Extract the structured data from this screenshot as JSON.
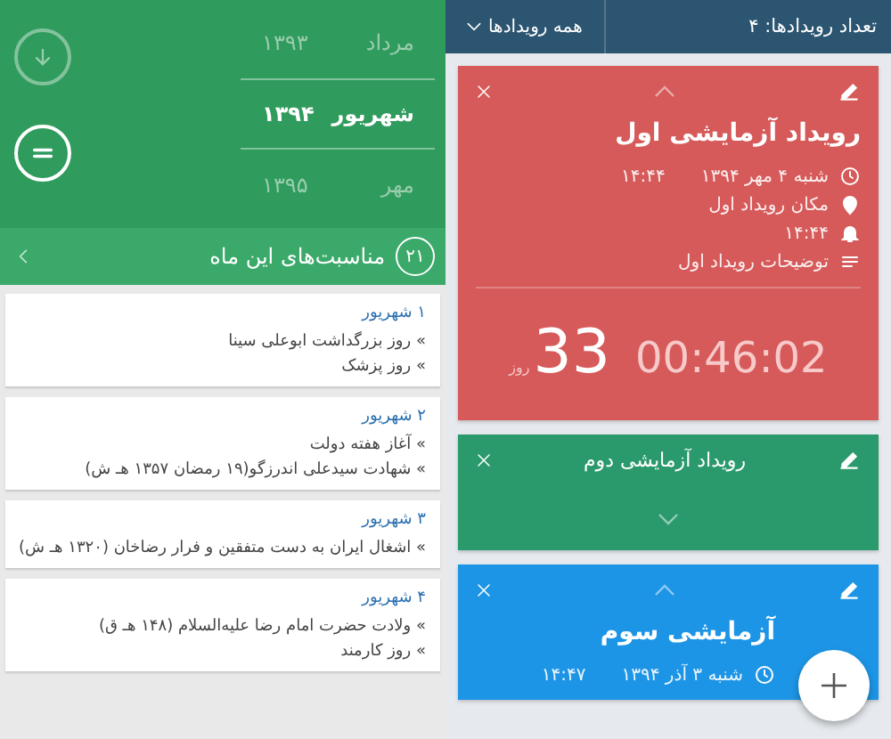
{
  "month_picker": {
    "rows": [
      {
        "month": "مرداد",
        "year": "۱۳۹۳",
        "selected": false
      },
      {
        "month": "شهریور",
        "year": "۱۳۹۴",
        "selected": true
      },
      {
        "month": "مهر",
        "year": "۱۳۹۵",
        "selected": false
      }
    ]
  },
  "occasions_bar": {
    "count": "۲۱",
    "title": "مناسبت‌های این ماه"
  },
  "occasions": [
    {
      "date": "۱ شهریور",
      "items": [
        "» روز بزرگداشت ابوعلی سینا",
        "» روز پزشک"
      ]
    },
    {
      "date": "۲ شهریور",
      "items": [
        "» آغاز هفته دولت",
        "» شهادت سیدعلی اندرزگو(۱۹ رمضان ۱۳۵۷ هـ ش)"
      ]
    },
    {
      "date": "۳ شهریور",
      "items": [
        "» اشغال ایران به دست متفقین و فرار رضاخان (۱۳۲۰ هـ ش)"
      ]
    },
    {
      "date": "۴ شهریور",
      "items": [
        "» ولادت حضرت امام رضا علیه‌السلام (۱۴۸ هـ ق)",
        "» روز کارمند"
      ]
    }
  ],
  "events_bar": {
    "count_label": "تعداد رویدادها: ۴",
    "filter": "همه رویدادها"
  },
  "events": [
    {
      "title": "رویداد آزمایشی اول",
      "color": "#d65a5a",
      "expanded": true,
      "date": "شنبه ۴ مهر ۱۳۹۴",
      "time": "۱۴:۴۴",
      "location": "مکان رویداد اول",
      "reminder": "۱۴:۴۴",
      "description": "توضیحات رویداد اول",
      "countdown": {
        "days": "33",
        "days_label": "روز",
        "time": "00:46:02"
      }
    },
    {
      "title": "رویداد آزمایشی دوم",
      "color": "#2a9a6c",
      "expanded": false
    },
    {
      "title": "آزمایشی سوم",
      "color": "#1d95e6",
      "expanded": true,
      "date": "شنبه ۳ آذر ۱۳۹۴",
      "time": "۱۴:۴۷"
    }
  ]
}
